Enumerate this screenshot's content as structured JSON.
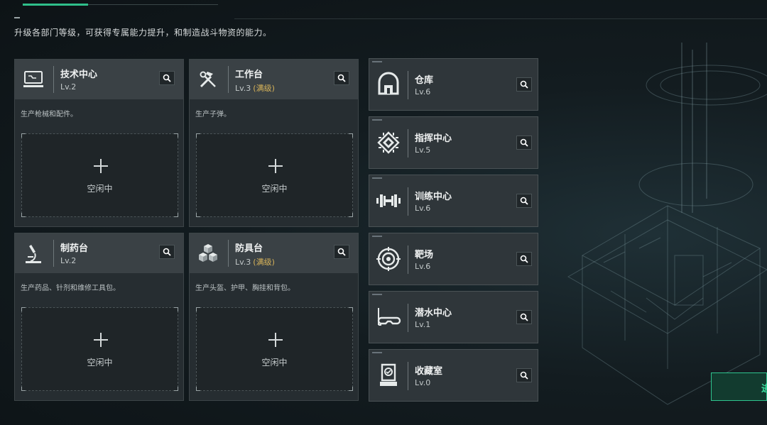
{
  "subtitle": "升级各部门等级，可获得专属能力提升，和制造战斗物资的能力。",
  "departments": [
    {
      "name": "技术中心",
      "level": "Lv.2",
      "max_tag": "",
      "desc": "生产枪械和配件。",
      "slot": "空闲中",
      "icon": "computer-icon"
    },
    {
      "name": "工作台",
      "level": "Lv.3",
      "max_tag": "(满级)",
      "desc": "生产子弹。",
      "slot": "空闲中",
      "icon": "tools-icon"
    },
    {
      "name": "制药台",
      "level": "Lv.2",
      "max_tag": "",
      "desc": "生产药品、针剂和维修工具包。",
      "slot": "空闲中",
      "icon": "microscope-icon"
    },
    {
      "name": "防具台",
      "level": "Lv.3",
      "max_tag": "(满级)",
      "desc": "生产头盔、护甲、胸挂和背包。",
      "slot": "空闲中",
      "icon": "boxes-icon"
    }
  ],
  "facilities": [
    {
      "name": "仓库",
      "level": "Lv.6",
      "icon": "warehouse-icon"
    },
    {
      "name": "指挥中心",
      "level": "Lv.5",
      "icon": "chip-icon"
    },
    {
      "name": "训练中心",
      "level": "Lv.6",
      "icon": "dumbbell-icon"
    },
    {
      "name": "靶场",
      "level": "Lv.6",
      "icon": "target-icon"
    },
    {
      "name": "潜水中心",
      "level": "Lv.1",
      "icon": "diving-mask-icon"
    },
    {
      "name": "收藏室",
      "level": "Lv.0",
      "icon": "trophy-case-icon"
    }
  ],
  "enter_button": "进",
  "colors": {
    "accent": "#2fbf8a",
    "max_level": "#d8b45a"
  }
}
